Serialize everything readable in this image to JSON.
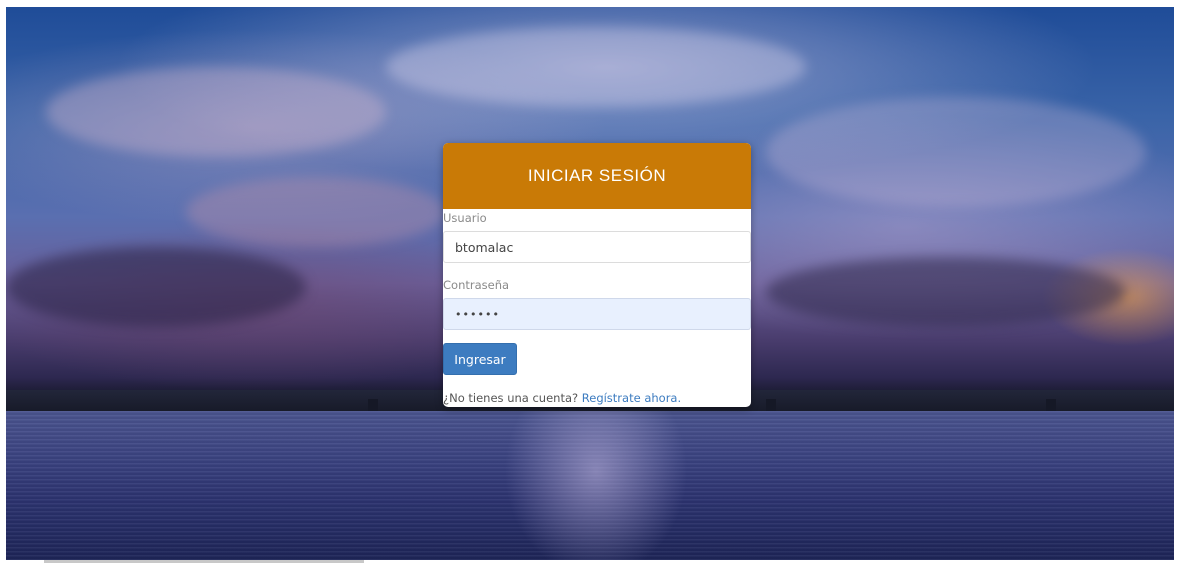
{
  "login": {
    "title": "INICIAR SESIÓN",
    "username_label": "Usuario",
    "username_value": "btomalac",
    "password_label": "Contraseña",
    "password_value": "••••••",
    "submit_label": "Ingresar",
    "signup_prompt": "¿No tienes una cuenta?",
    "signup_link": "Regístrate ahora."
  },
  "colors": {
    "header": "#c97a06",
    "button": "#3d7cc0",
    "link": "#3d7cc0"
  }
}
